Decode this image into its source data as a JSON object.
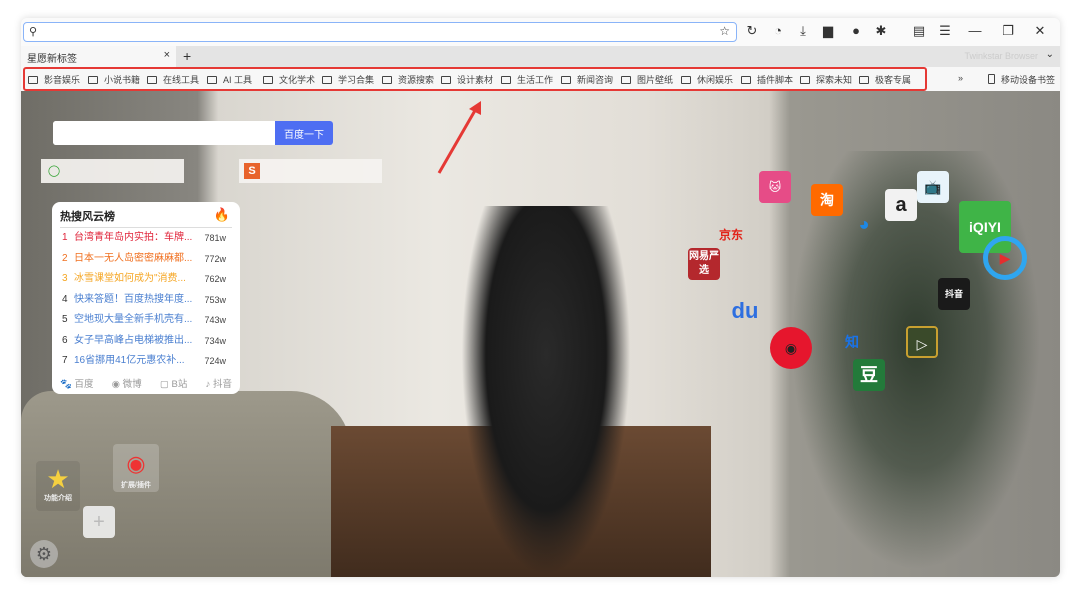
{
  "toolbar": {
    "address_value": "",
    "icons": [
      "search-icon",
      "star-icon",
      "reload-icon",
      "history-icon",
      "download-icon",
      "screenshot-icon",
      "theme-icon",
      "extensions-icon",
      "reader-icon",
      "menu-icon",
      "minimize-icon",
      "restore-icon",
      "close-icon"
    ]
  },
  "tabs": {
    "active": "星愿新标签",
    "new_tab": "+",
    "close": "×",
    "brand": "Twinkstar Browser",
    "dropdown": "⌄"
  },
  "bookmarks": {
    "items": [
      "影音娱乐",
      "小说书籍",
      "在线工具",
      "AI 工具",
      "文化学术",
      "学习合集",
      "资源搜索",
      "设计素材",
      "生活工作",
      "新闻咨询",
      "图片壁纸",
      "休闲娱乐",
      "插件脚本",
      "探索未知",
      "极客专属"
    ],
    "more": "»",
    "mobile": "移动设备书签",
    "highlight_color": "#e53935"
  },
  "search": {
    "placeholder": "",
    "button": "百度一下"
  },
  "hot_list": {
    "title": "热搜风云榜",
    "items": [
      {
        "rank": "1",
        "text": "台湾青年岛内实拍：车牌...",
        "count": "781w",
        "color": "#e0243a"
      },
      {
        "rank": "2",
        "text": "日本一无人岛密密麻麻都...",
        "count": "772w",
        "color": "#f07020"
      },
      {
        "rank": "3",
        "text": "冰雪课堂如何成为\"消费...",
        "count": "762w",
        "color": "#f5a623"
      },
      {
        "rank": "4",
        "text": "快来答题！百度热搜年度...",
        "count": "753w",
        "color": "#4a7fd0"
      },
      {
        "rank": "5",
        "text": "空地现大量全新手机壳有...",
        "count": "743w",
        "color": "#4a7fd0"
      },
      {
        "rank": "6",
        "text": "女子早高峰占电梯被推出...",
        "count": "734w",
        "color": "#4a7fd0"
      },
      {
        "rank": "7",
        "text": "16省挪用41亿元惠农补...",
        "count": "724w",
        "color": "#4a7fd0"
      }
    ],
    "sources": [
      "百度",
      "微博",
      "B站",
      "抖音"
    ]
  },
  "apps": {
    "taobao": "淘",
    "jd": "京东",
    "yanxuan": "网易严选",
    "iqiyi": "iQIYI",
    "douyin": "抖音",
    "zhihu": "知",
    "douban": "豆",
    "amazon": "a",
    "baidu": "du"
  },
  "widgets": {
    "intro": "功能介绍",
    "extensions": "扩展/插件",
    "add": "+"
  }
}
